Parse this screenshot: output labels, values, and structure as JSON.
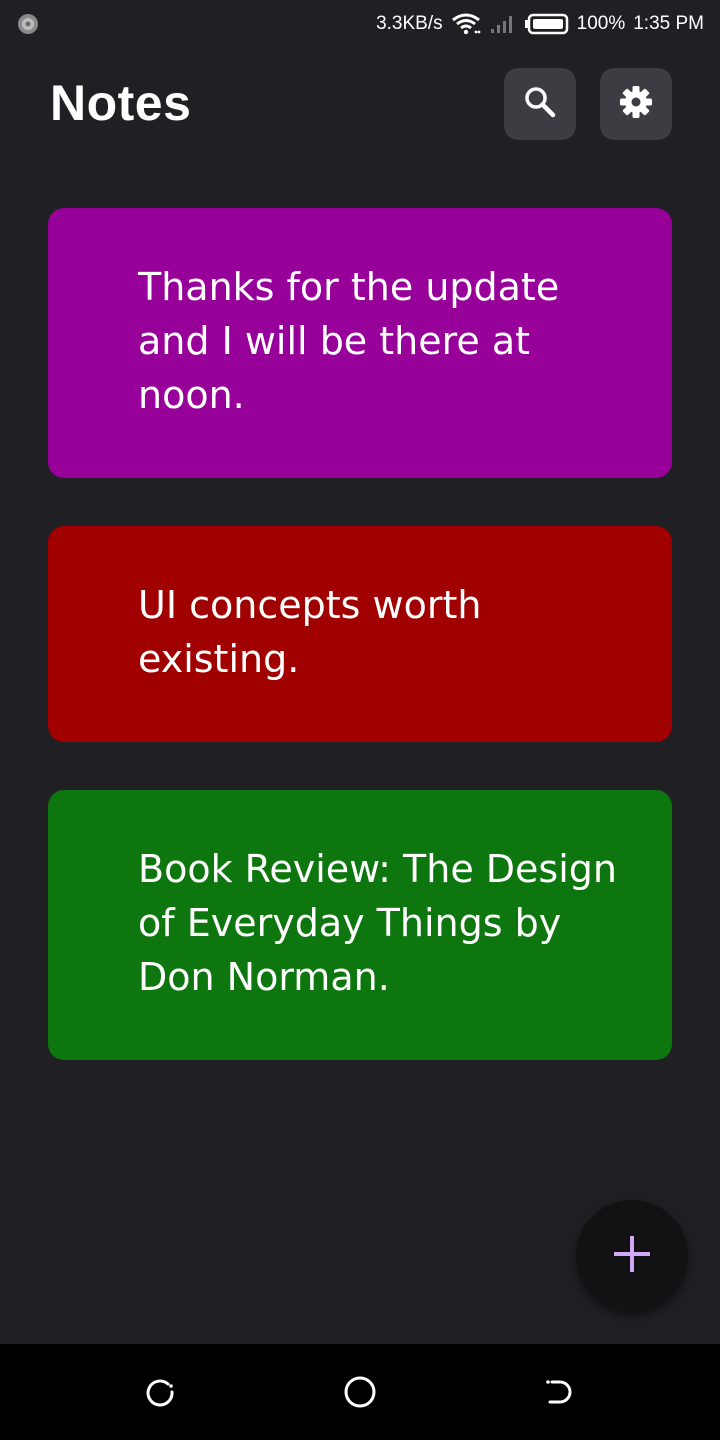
{
  "status_bar": {
    "network_speed": "3.3KB/s",
    "battery_percent": "100%",
    "time": "1:35 PM",
    "icons": [
      "app-indicator-icon",
      "wifi-icon",
      "signal-icon",
      "battery-icon"
    ]
  },
  "header": {
    "title": "Notes",
    "search_icon": "search-icon",
    "settings_icon": "gear-icon"
  },
  "notes": [
    {
      "text": "Thanks for the update and I will be there at noon.",
      "color": "#970099"
    },
    {
      "text": "UI concepts worth existing.",
      "color": "#a00000"
    },
    {
      "text": "Book Review: The Design of Everyday Things by Don Norman.",
      "color": "#0e760e"
    }
  ],
  "fab": {
    "icon": "plus-icon",
    "icon_color": "#d0a8f5"
  },
  "nav_bar": {
    "icons": [
      "recent-apps-icon",
      "home-icon",
      "back-icon"
    ]
  },
  "colors": {
    "background": "#202024",
    "icon_button_bg": "#3c3c42",
    "fab_bg": "#121214",
    "nav_bar_bg": "#000000"
  }
}
